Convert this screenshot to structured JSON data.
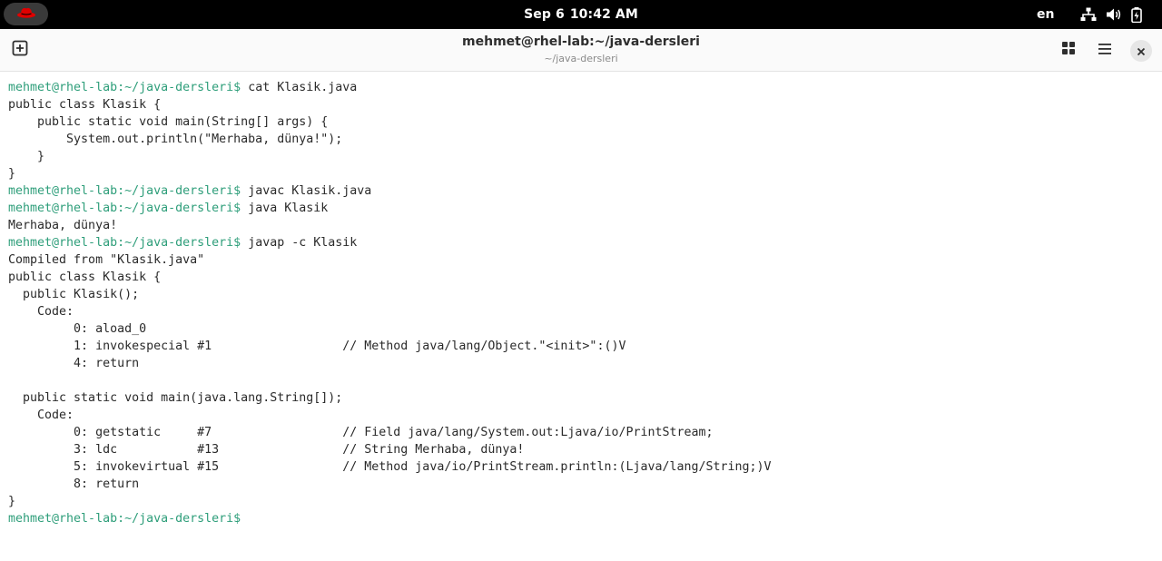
{
  "topbar": {
    "date": "Sep 6",
    "time": "10:42 AM",
    "language": "en",
    "icons": [
      "redhat-logo-icon",
      "network-icon",
      "volume-icon",
      "battery-icon"
    ]
  },
  "window": {
    "title": "mehmet@rhel-lab:~/java-dersleri",
    "subtitle": "~/java-dersleri",
    "buttons": [
      "new-tab-icon",
      "tab-overview-icon",
      "menu-icon",
      "close-icon"
    ]
  },
  "terminal": {
    "prompt": "mehmet@rhel-lab:~/java-dersleri$",
    "prompt_color": "#2e9e7a",
    "lines": [
      {
        "prompt": true,
        "text": " cat Klasik.java"
      },
      {
        "prompt": false,
        "text": "public class Klasik {"
      },
      {
        "prompt": false,
        "text": "    public static void main(String[] args) {"
      },
      {
        "prompt": false,
        "text": "        System.out.println(\"Merhaba, dünya!\");"
      },
      {
        "prompt": false,
        "text": "    }"
      },
      {
        "prompt": false,
        "text": "}"
      },
      {
        "prompt": true,
        "text": " javac Klasik.java"
      },
      {
        "prompt": true,
        "text": " java Klasik"
      },
      {
        "prompt": false,
        "text": "Merhaba, dünya!"
      },
      {
        "prompt": true,
        "text": " javap -c Klasik"
      },
      {
        "prompt": false,
        "text": "Compiled from \"Klasik.java\""
      },
      {
        "prompt": false,
        "text": "public class Klasik {"
      },
      {
        "prompt": false,
        "text": "  public Klasik();"
      },
      {
        "prompt": false,
        "text": "    Code:"
      },
      {
        "prompt": false,
        "text": "         0: aload_0"
      },
      {
        "prompt": false,
        "text": "         1: invokespecial #1                  // Method java/lang/Object.\"<init>\":()V"
      },
      {
        "prompt": false,
        "text": "         4: return"
      },
      {
        "prompt": false,
        "text": ""
      },
      {
        "prompt": false,
        "text": "  public static void main(java.lang.String[]);"
      },
      {
        "prompt": false,
        "text": "    Code:"
      },
      {
        "prompt": false,
        "text": "         0: getstatic     #7                  // Field java/lang/System.out:Ljava/io/PrintStream;"
      },
      {
        "prompt": false,
        "text": "         3: ldc           #13                 // String Merhaba, dünya!"
      },
      {
        "prompt": false,
        "text": "         5: invokevirtual #15                 // Method java/io/PrintStream.println:(Ljava/lang/String;)V"
      },
      {
        "prompt": false,
        "text": "         8: return"
      },
      {
        "prompt": false,
        "text": "}"
      },
      {
        "prompt": true,
        "text": ""
      }
    ]
  }
}
